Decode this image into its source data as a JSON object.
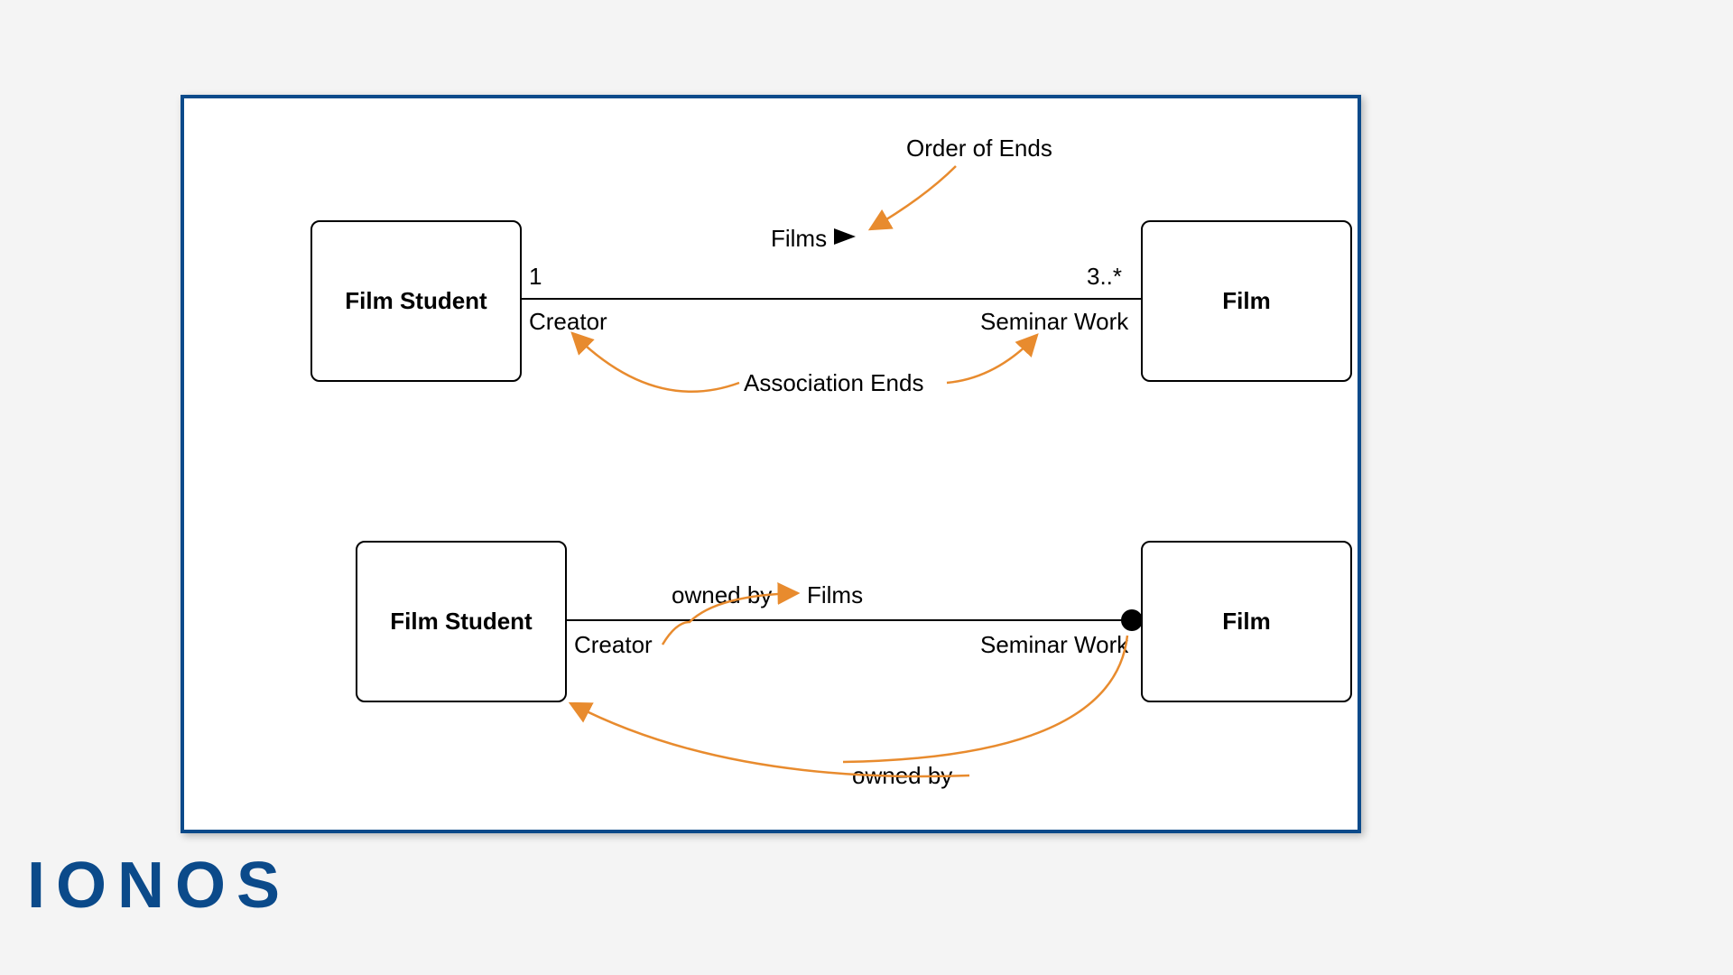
{
  "logo": "IONOS",
  "top": {
    "left_box": "Film Student",
    "right_box": "Film",
    "mult_left": "1",
    "mult_right": "3..*",
    "assoc_name": "Films",
    "role_left": "Creator",
    "role_right": "Seminar Work",
    "annot_order": "Order of Ends",
    "annot_ends": "Association Ends"
  },
  "bottom": {
    "left_box": "Film Student",
    "right_box": "Film",
    "assoc_name": "Films",
    "role_left": "Creator",
    "role_right": "Seminar Work",
    "owned_by_top": "owned by",
    "owned_by_bottom": "owned by"
  }
}
